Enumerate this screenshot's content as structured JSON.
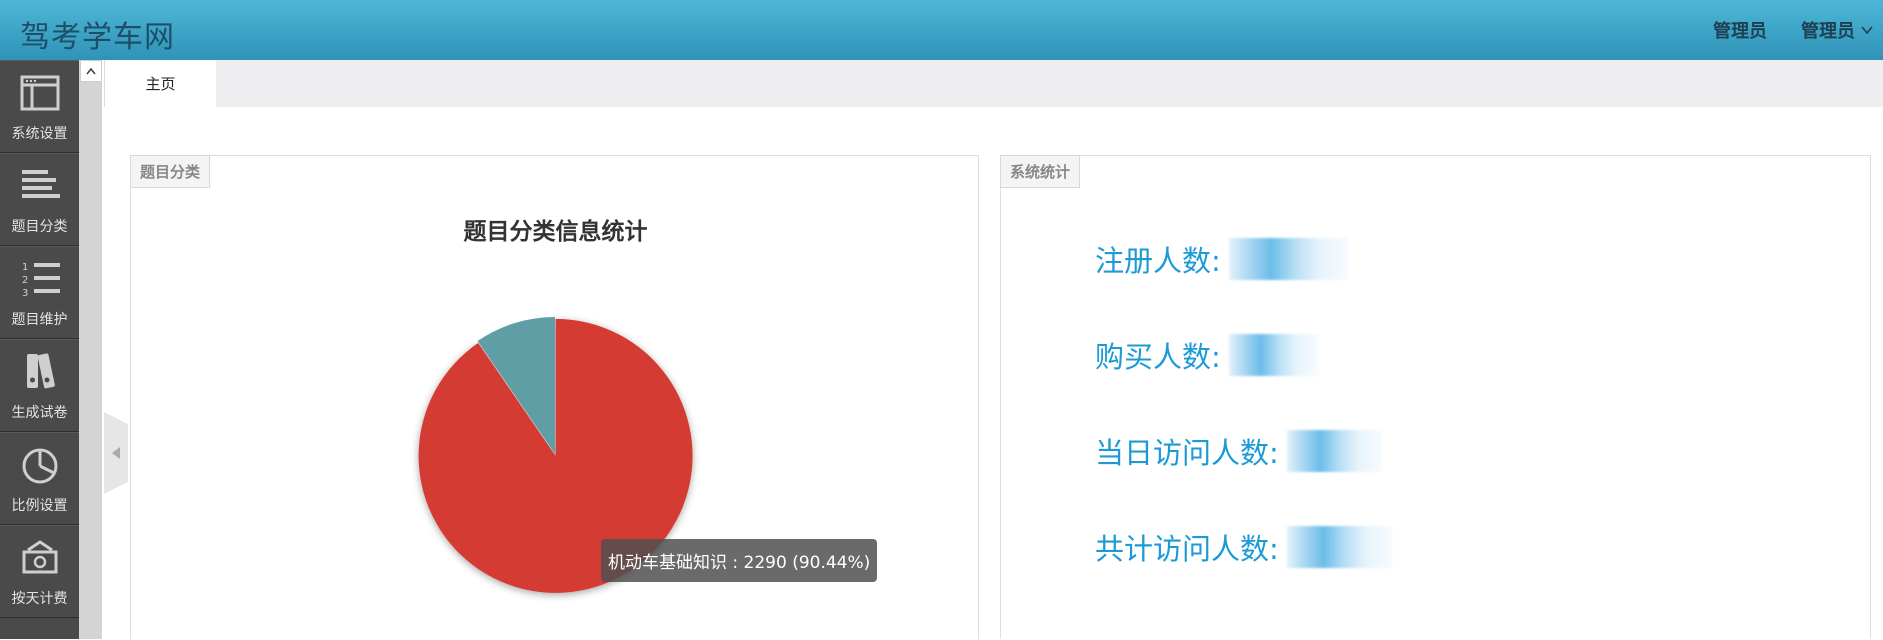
{
  "app": {
    "title": "驾考学车网"
  },
  "header": {
    "link": "管理员",
    "user": "管理员"
  },
  "sidebar": {
    "items": [
      {
        "label": "系统设置",
        "icon": "window-icon"
      },
      {
        "label": "题目分类",
        "icon": "align-left-icon"
      },
      {
        "label": "题目维护",
        "icon": "ordered-list-icon"
      },
      {
        "label": "生成试卷",
        "icon": "binders-icon"
      },
      {
        "label": "比例设置",
        "icon": "pie-icon"
      },
      {
        "label": "按天计费",
        "icon": "money-icon"
      }
    ]
  },
  "tabs": [
    {
      "label": "主页",
      "active": true
    }
  ],
  "panels": {
    "category": {
      "tag": "题目分类"
    },
    "stats": {
      "tag": "系统统计",
      "items": [
        {
          "label": "注册人数:"
        },
        {
          "label": "购买人数:"
        },
        {
          "label": "当日访问人数:"
        },
        {
          "label": "共计访问人数:"
        }
      ]
    }
  },
  "chart_data": {
    "type": "pie",
    "title": "题目分类信息统计",
    "slices": [
      {
        "name": "机动车基础知识",
        "value": 2290,
        "percent": 90.44,
        "color": "#d43a32"
      },
      {
        "value": 242,
        "percent": 9.56,
        "color": "#5f9ea4"
      }
    ],
    "tooltip": "机动车基础知识 : 2290 (90.44%)"
  },
  "colors": {
    "accent": "#1c9ad6",
    "header": "#3ea5c8",
    "sidebar": "#4a4a4a"
  }
}
